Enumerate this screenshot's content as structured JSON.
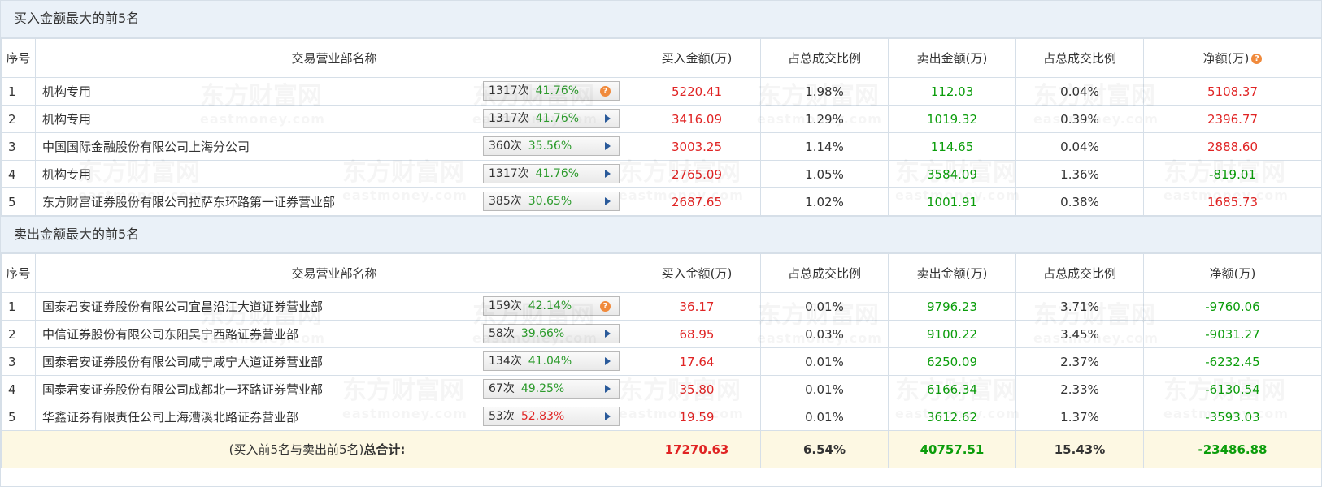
{
  "buy_section": {
    "title": "买入金额最大的前5名",
    "headers": {
      "idx": "序号",
      "name": "交易营业部名称",
      "buy": "买入金额(万)",
      "buy_ratio": "占总成交比例",
      "sell": "卖出金额(万)",
      "sell_ratio": "占总成交比例",
      "net": "净额(万)"
    },
    "rows": [
      {
        "idx": "1",
        "name": "机构专用",
        "times": "1317次",
        "pct": "41.76%",
        "pct_color": "green",
        "icon": "question-icon",
        "buy": "5220.41",
        "buy_ratio": "1.98%",
        "sell": "112.03",
        "sell_ratio": "0.04%",
        "net": "5108.37"
      },
      {
        "idx": "2",
        "name": "机构专用",
        "times": "1317次",
        "pct": "41.76%",
        "pct_color": "green",
        "icon": "arrow-right-icon",
        "buy": "3416.09",
        "buy_ratio": "1.29%",
        "sell": "1019.32",
        "sell_ratio": "0.39%",
        "net": "2396.77"
      },
      {
        "idx": "3",
        "name": "中国国际金融股份有限公司上海分公司",
        "times": "360次",
        "pct": "35.56%",
        "pct_color": "green",
        "icon": "arrow-right-icon",
        "buy": "3003.25",
        "buy_ratio": "1.14%",
        "sell": "114.65",
        "sell_ratio": "0.04%",
        "net": "2888.60"
      },
      {
        "idx": "4",
        "name": "机构专用",
        "times": "1317次",
        "pct": "41.76%",
        "pct_color": "green",
        "icon": "arrow-right-icon",
        "buy": "2765.09",
        "buy_ratio": "1.05%",
        "sell": "3584.09",
        "sell_ratio": "1.36%",
        "net": "-819.01"
      },
      {
        "idx": "5",
        "name": "东方财富证券股份有限公司拉萨东环路第一证券营业部",
        "times": "385次",
        "pct": "30.65%",
        "pct_color": "green",
        "icon": "arrow-right-icon",
        "buy": "2687.65",
        "buy_ratio": "1.02%",
        "sell": "1001.91",
        "sell_ratio": "0.38%",
        "net": "1685.73"
      }
    ]
  },
  "sell_section": {
    "title": "卖出金额最大的前5名",
    "headers": {
      "idx": "序号",
      "name": "交易营业部名称",
      "buy": "买入金额(万)",
      "buy_ratio": "占总成交比例",
      "sell": "卖出金额(万)",
      "sell_ratio": "占总成交比例",
      "net": "净额(万)"
    },
    "rows": [
      {
        "idx": "1",
        "name": "国泰君安证券股份有限公司宜昌沿江大道证券营业部",
        "times": "159次",
        "pct": "42.14%",
        "pct_color": "green",
        "icon": "question-icon",
        "buy": "36.17",
        "buy_ratio": "0.01%",
        "sell": "9796.23",
        "sell_ratio": "3.71%",
        "net": "-9760.06"
      },
      {
        "idx": "2",
        "name": "中信证券股份有限公司东阳吴宁西路证券营业部",
        "times": "58次",
        "pct": "39.66%",
        "pct_color": "green",
        "icon": "arrow-right-icon",
        "buy": "68.95",
        "buy_ratio": "0.03%",
        "sell": "9100.22",
        "sell_ratio": "3.45%",
        "net": "-9031.27"
      },
      {
        "idx": "3",
        "name": "国泰君安证券股份有限公司咸宁咸宁大道证券营业部",
        "times": "134次",
        "pct": "41.04%",
        "pct_color": "green",
        "icon": "arrow-right-icon",
        "buy": "17.64",
        "buy_ratio": "0.01%",
        "sell": "6250.09",
        "sell_ratio": "2.37%",
        "net": "-6232.45"
      },
      {
        "idx": "4",
        "name": "国泰君安证券股份有限公司成都北一环路证券营业部",
        "times": "67次",
        "pct": "49.25%",
        "pct_color": "green",
        "icon": "arrow-right-icon",
        "buy": "35.80",
        "buy_ratio": "0.01%",
        "sell": "6166.34",
        "sell_ratio": "2.33%",
        "net": "-6130.54"
      },
      {
        "idx": "5",
        "name": "华鑫证券有限责任公司上海漕溪北路证券营业部",
        "times": "53次",
        "pct": "52.83%",
        "pct_color": "red",
        "icon": "arrow-right-icon",
        "buy": "19.59",
        "buy_ratio": "0.01%",
        "sell": "3612.62",
        "sell_ratio": "1.37%",
        "net": "-3593.03"
      }
    ]
  },
  "total": {
    "label_prefix": "(买入前5名与卖出前5名)",
    "label_bold": "总合计:",
    "buy": "17270.63",
    "buy_ratio": "6.54%",
    "sell": "40757.51",
    "sell_ratio": "15.43%",
    "net": "-23486.88"
  },
  "watermark": {
    "cn": "东方财富网",
    "en": "eastmoney.com"
  },
  "colors": {
    "header_bg": "#eaf1f8",
    "border": "#d6dfe8",
    "red": "#e02424",
    "green": "#0b9d0b",
    "total_bg": "#fdf8e3",
    "question_icon": "#f08a3c"
  }
}
